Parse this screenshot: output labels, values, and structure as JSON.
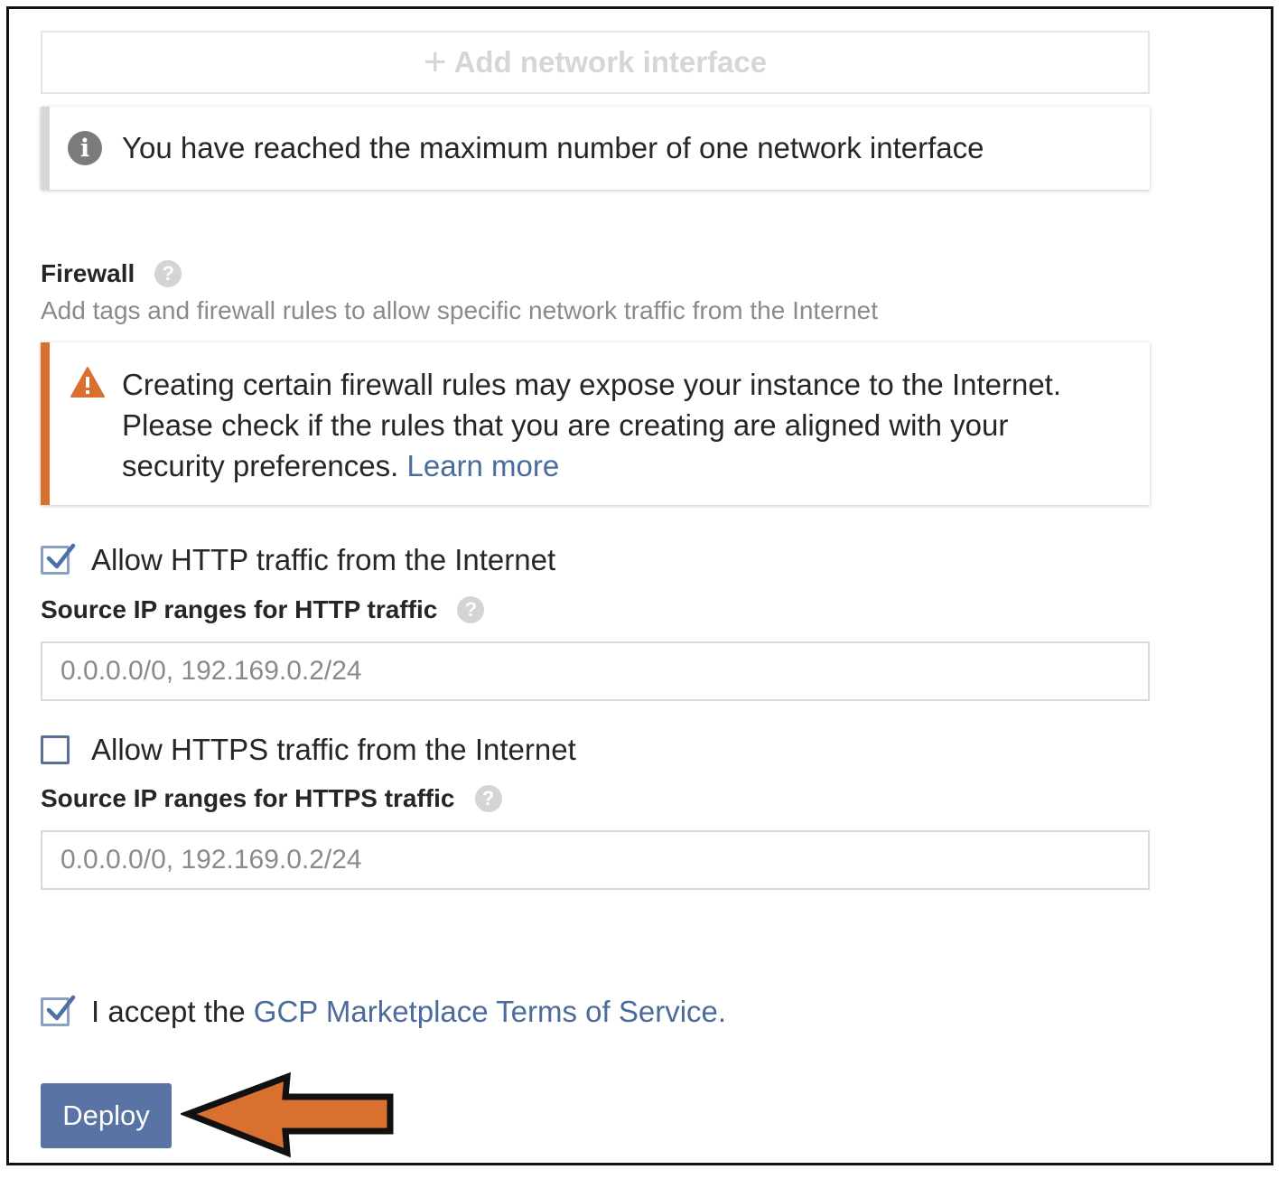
{
  "network": {
    "add_interface_label": "Add network interface",
    "add_interface_icon": "plus-icon",
    "max_notice": "You have reached the maximum number of one network interface",
    "info_icon": "info-icon"
  },
  "firewall": {
    "title": "Firewall",
    "subtitle": "Add tags and firewall rules to allow specific network traffic from the Internet",
    "help_icon": "help-icon",
    "warning_line1": "Creating certain firewall rules may expose your instance to the Internet.",
    "warning_line2": "Please check if the rules that you are creating are aligned with your",
    "warning_line3": "security preferences.",
    "learn_more": "Learn more",
    "warning_color": "#d9702f"
  },
  "http": {
    "checkbox_label": "Allow HTTP traffic from the Internet",
    "checked": true,
    "source_label": "Source IP ranges for HTTP traffic",
    "placeholder": "0.0.0.0/0, 192.169.0.2/24"
  },
  "https": {
    "checkbox_label": "Allow HTTPS traffic from the Internet",
    "checked": false,
    "source_label": "Source IP ranges for HTTPS traffic",
    "placeholder": "0.0.0.0/0, 192.169.0.2/24"
  },
  "terms": {
    "prefix": "I accept the",
    "link": "GCP Marketplace Terms of Service.",
    "checked": true
  },
  "actions": {
    "deploy_label": "Deploy",
    "deploy_color": "#5974a4",
    "annotation_arrow_color": "#d9702f"
  }
}
